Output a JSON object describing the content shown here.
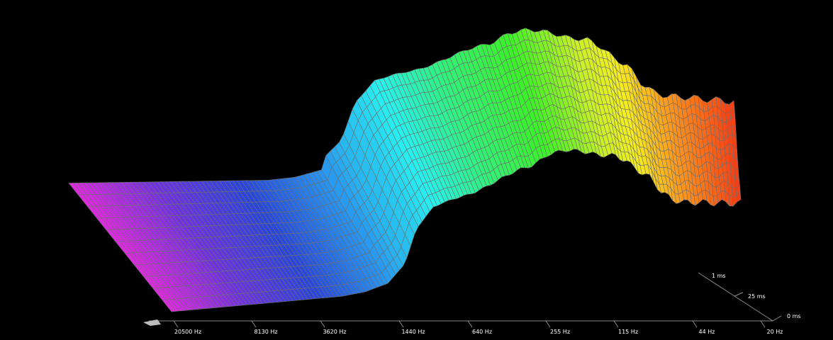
{
  "chart_data": {
    "type": "waterfall-3d",
    "title": "",
    "xlabel": "",
    "ylabel": "",
    "zlabel": "",
    "x_axis": {
      "scale": "log",
      "direction": "descending",
      "tick_labels": [
        "20500 Hz",
        "8130 Hz",
        "3620 Hz",
        "1440 Hz",
        "640 Hz",
        "255 Hz",
        "115 Hz",
        "44 Hz",
        "20 Hz"
      ],
      "tick_values_hz": [
        20500,
        8130,
        3620,
        1440,
        640,
        255,
        115,
        44,
        20
      ]
    },
    "time_axis": {
      "tick_labels": [
        "0 ms",
        "25 ms"
      ],
      "tick_values_ms": [
        0,
        25
      ]
    },
    "grid": true,
    "colormap": "rainbow by frequency (red = low, magenta = high)",
    "colors": {
      "background": "#000000",
      "mesh_line": "#6f6f6f",
      "axis": "#8a8a8a",
      "text": "#ffffff"
    }
  }
}
